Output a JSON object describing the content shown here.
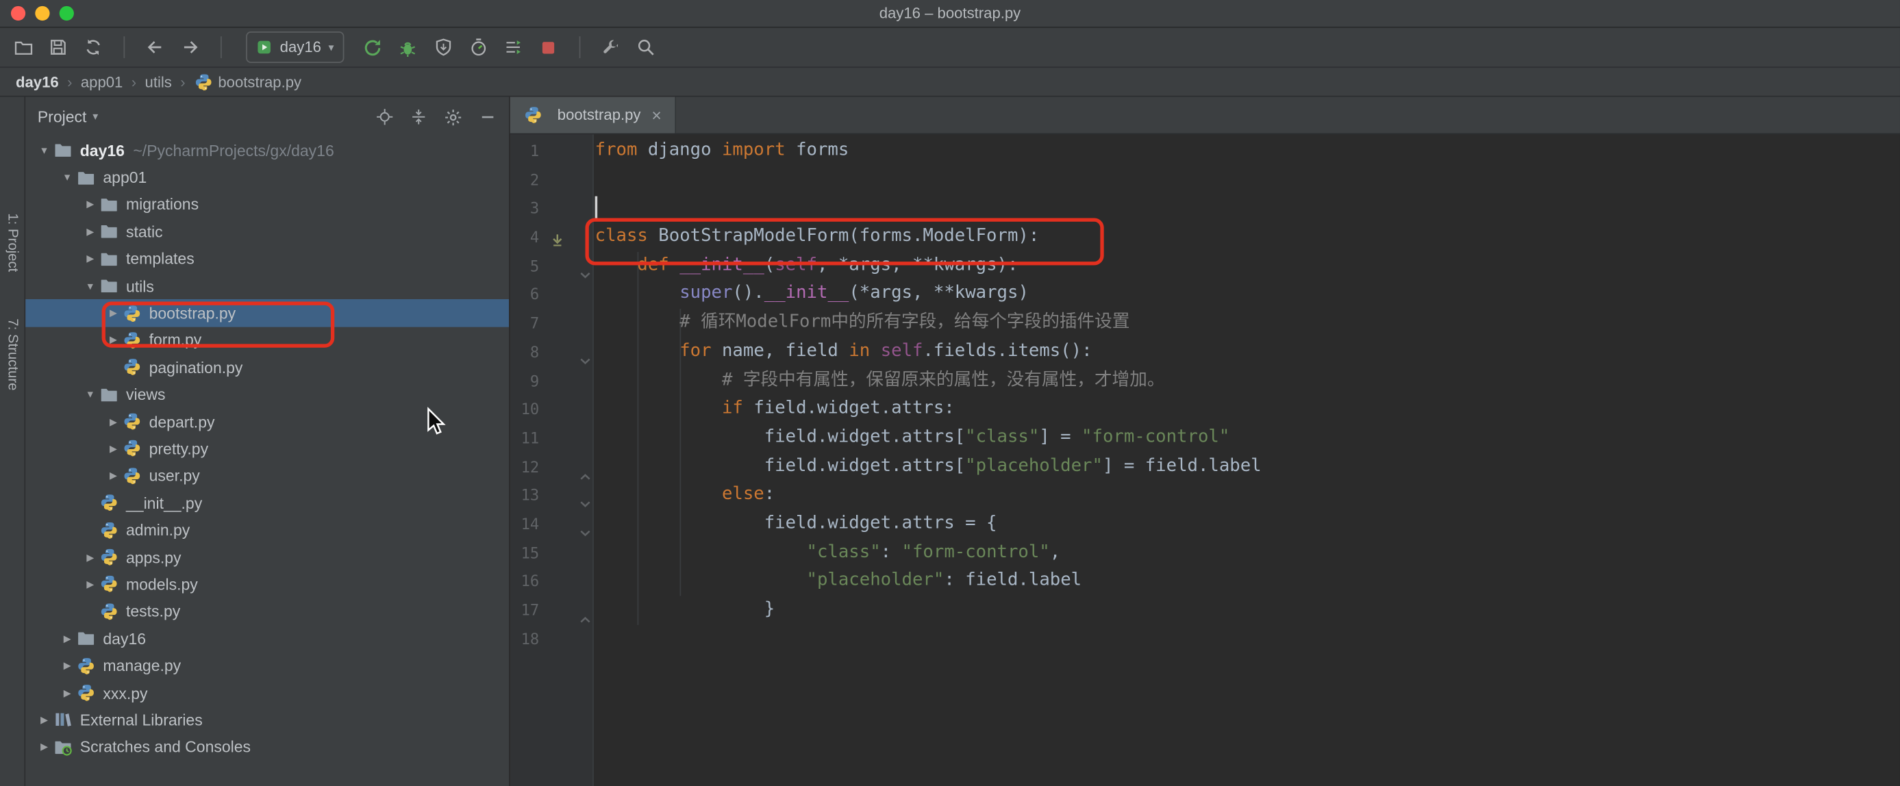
{
  "window": {
    "title": "day16 – bootstrap.py",
    "traffic_lights": [
      "#ff5f57",
      "#febc2e",
      "#28c840"
    ]
  },
  "toolbar": {
    "file_icons": [
      "open-icon",
      "save-icon",
      "sync-icon"
    ],
    "nav_icons": [
      "back-icon",
      "forward-icon"
    ],
    "run_config": {
      "label": "day16",
      "icon": "run-config-icon",
      "chevron": "▾"
    },
    "run_icons": [
      "rerun-icon",
      "debug-icon",
      "coverage-icon",
      "profiler-icon",
      "concurrency-icon",
      "stop-icon"
    ],
    "tail_icons": [
      "tools-icon",
      "search-icon"
    ]
  },
  "breadcrumbs": {
    "separator": "›",
    "items": [
      {
        "label": "day16",
        "bold": true
      },
      {
        "label": "app01"
      },
      {
        "label": "utils"
      },
      {
        "label": "bootstrap.py",
        "icon": "python-file-icon"
      }
    ]
  },
  "tool_stripe": {
    "buttons": [
      {
        "label": "1: Project"
      },
      {
        "label": "7: Structure"
      }
    ]
  },
  "project_panel": {
    "title": "Project",
    "title_chevron": "▾",
    "header_icons": [
      "locate-icon",
      "collapse-all-icon",
      "settings-icon",
      "hide-icon"
    ],
    "tree": [
      {
        "label": "day16",
        "suffix": "~/PycharmProjects/gx/day16",
        "level": 0,
        "arrow": "open",
        "icon": "folder-icon",
        "bold": true
      },
      {
        "label": "app01",
        "level": 1,
        "arrow": "open",
        "icon": "folder-icon"
      },
      {
        "label": "migrations",
        "level": 2,
        "arrow": "closed",
        "icon": "folder-icon"
      },
      {
        "label": "static",
        "level": 2,
        "arrow": "closed",
        "icon": "folder-icon"
      },
      {
        "label": "templates",
        "level": 2,
        "arrow": "closed",
        "icon": "folder-icon"
      },
      {
        "label": "utils",
        "level": 2,
        "arrow": "open",
        "icon": "folder-icon"
      },
      {
        "label": "bootstrap.py",
        "level": 3,
        "arrow": "closed",
        "icon": "python-file-icon",
        "selected": true
      },
      {
        "label": "form.py",
        "level": 3,
        "arrow": "closed",
        "icon": "python-file-icon"
      },
      {
        "label": "pagination.py",
        "level": 3,
        "arrow": "none",
        "icon": "python-file-icon"
      },
      {
        "label": "views",
        "level": 2,
        "arrow": "open",
        "icon": "folder-icon"
      },
      {
        "label": "depart.py",
        "level": 3,
        "arrow": "closed",
        "icon": "python-file-icon"
      },
      {
        "label": "pretty.py",
        "level": 3,
        "arrow": "closed",
        "icon": "python-file-icon"
      },
      {
        "label": "user.py",
        "level": 3,
        "arrow": "closed",
        "icon": "python-file-icon"
      },
      {
        "label": "__init__.py",
        "level": 2,
        "arrow": "none",
        "icon": "python-file-icon"
      },
      {
        "label": "admin.py",
        "level": 2,
        "arrow": "none",
        "icon": "python-file-icon"
      },
      {
        "label": "apps.py",
        "level": 2,
        "arrow": "closed",
        "icon": "python-file-icon"
      },
      {
        "label": "models.py",
        "level": 2,
        "arrow": "closed",
        "icon": "python-file-icon"
      },
      {
        "label": "tests.py",
        "level": 2,
        "arrow": "none",
        "icon": "python-file-icon"
      },
      {
        "label": "day16",
        "level": 1,
        "arrow": "closed",
        "icon": "folder-icon"
      },
      {
        "label": "manage.py",
        "level": 1,
        "arrow": "closed",
        "icon": "python-file-icon"
      },
      {
        "label": "xxx.py",
        "level": 1,
        "arrow": "closed",
        "icon": "python-file-icon"
      },
      {
        "label": "External Libraries",
        "level": 0,
        "arrow": "closed",
        "icon": "library-icon"
      },
      {
        "label": "Scratches and Consoles",
        "level": 0,
        "arrow": "closed",
        "icon": "scratch-icon"
      }
    ]
  },
  "editor": {
    "tab": {
      "label": "bootstrap.py",
      "icon": "python-file-icon",
      "close_glyph": "×"
    },
    "caret": {
      "line": 3,
      "col": 0
    },
    "gutter_marks": {
      "class_marker_line": 4,
      "fold_open_lines": [
        5,
        8,
        13,
        14
      ],
      "fold_close_lines": [
        12,
        17
      ]
    },
    "lines": [
      [
        [
          "kw",
          "from"
        ],
        [
          "pl",
          " django "
        ],
        [
          "kw",
          "import"
        ],
        [
          "pl",
          " forms"
        ]
      ],
      [],
      [],
      [
        [
          "kw",
          "class"
        ],
        [
          "pl",
          " BootStrapModelForm(forms.ModelForm):"
        ]
      ],
      [
        [
          "pl",
          "    "
        ],
        [
          "kw",
          "def"
        ],
        [
          "pl",
          " "
        ],
        [
          "mg",
          "__init__"
        ],
        [
          "pl",
          "("
        ],
        [
          "sf",
          "self"
        ],
        [
          "pl",
          ", *args, **kwargs):"
        ]
      ],
      [
        [
          "pl",
          "        "
        ],
        [
          "bi",
          "super"
        ],
        [
          "pl",
          "()."
        ],
        [
          "mg",
          "__init__"
        ],
        [
          "pl",
          "(*args, **kwargs)"
        ]
      ],
      [
        [
          "pl",
          "        "
        ],
        [
          "cm",
          "# 循环ModelForm中的所有字段，给每个字段的插件设置"
        ]
      ],
      [
        [
          "pl",
          "        "
        ],
        [
          "kw",
          "for"
        ],
        [
          "pl",
          " name, field "
        ],
        [
          "kw",
          "in"
        ],
        [
          "pl",
          " "
        ],
        [
          "sf",
          "self"
        ],
        [
          "pl",
          ".fields.items():"
        ]
      ],
      [
        [
          "pl",
          "            "
        ],
        [
          "cm",
          "# 字段中有属性，保留原来的属性，没有属性，才增加。"
        ]
      ],
      [
        [
          "pl",
          "            "
        ],
        [
          "kw",
          "if"
        ],
        [
          "pl",
          " field.widget.attrs:"
        ]
      ],
      [
        [
          "pl",
          "                field.widget.attrs["
        ],
        [
          "st",
          "\"class\""
        ],
        [
          "pl",
          "] = "
        ],
        [
          "st",
          "\"form-control\""
        ]
      ],
      [
        [
          "pl",
          "                field.widget.attrs["
        ],
        [
          "st",
          "\"placeholder\""
        ],
        [
          "pl",
          "] = field.label"
        ]
      ],
      [
        [
          "pl",
          "            "
        ],
        [
          "kw",
          "else"
        ],
        [
          "pl",
          ":"
        ]
      ],
      [
        [
          "pl",
          "                field.widget.attrs = {"
        ]
      ],
      [
        [
          "pl",
          "                    "
        ],
        [
          "st",
          "\"class\""
        ],
        [
          "pl",
          ": "
        ],
        [
          "st",
          "\"form-control\""
        ],
        [
          "pl",
          ","
        ]
      ],
      [
        [
          "pl",
          "                    "
        ],
        [
          "st",
          "\"placeholder\""
        ],
        [
          "pl",
          ": field.label"
        ]
      ],
      [
        [
          "pl",
          "                }"
        ]
      ],
      []
    ]
  },
  "syntax_colors": {
    "kw": "#cc7832",
    "pl": "#a9b7c6",
    "mg": "#b36bb3",
    "sf": "#94558d",
    "bi": "#8888c6",
    "st": "#6a8759",
    "cm": "#808080"
  },
  "ui_colors": {
    "selection": "#3e6185",
    "annotation_red": "#e3301f",
    "editor_bg": "#2b2b2b",
    "panel_bg": "#3c3f41"
  }
}
